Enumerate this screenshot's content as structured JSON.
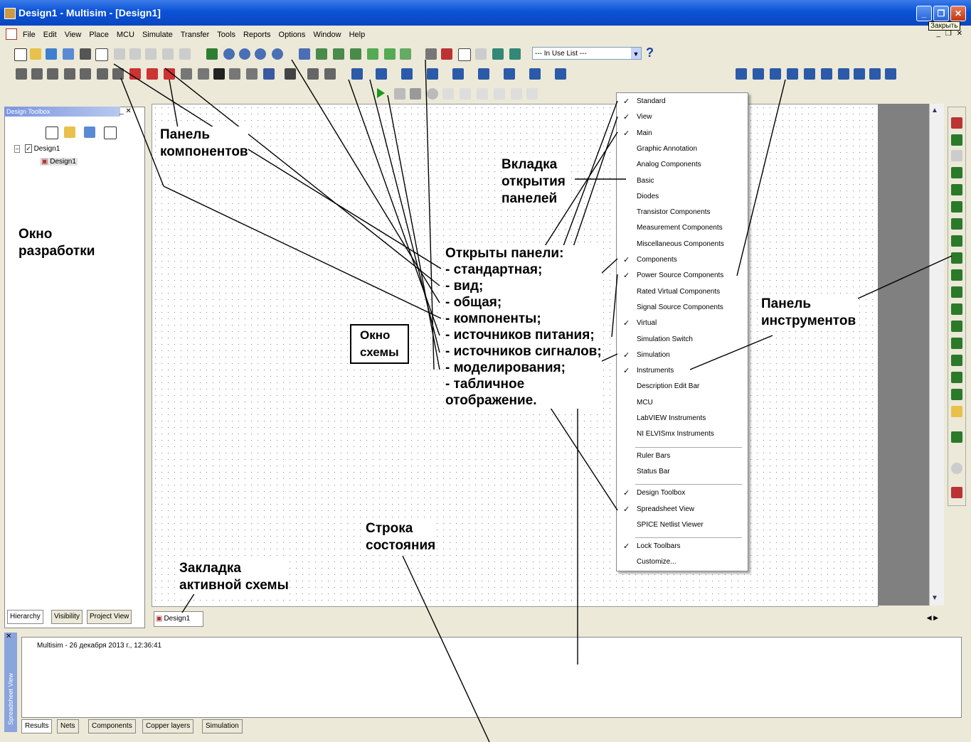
{
  "window": {
    "title": "Design1 - Multisim - [Design1]",
    "tooltip": "Закрыть"
  },
  "menubar": [
    "File",
    "Edit",
    "View",
    "Place",
    "MCU",
    "Simulate",
    "Transfer",
    "Tools",
    "Reports",
    "Options",
    "Window",
    "Help"
  ],
  "toolbar": {
    "inuse_list": "--- In Use List ---",
    "help": "?"
  },
  "design_toolbox": {
    "title": "Design Toolbox",
    "root": "Design1",
    "child": "Design1",
    "tabs": [
      "Hierarchy",
      "Visibility",
      "Project View"
    ]
  },
  "sheet_tab": "Design1",
  "view_menu": {
    "items": [
      {
        "label": "Standard",
        "checked": true
      },
      {
        "label": "View",
        "checked": true
      },
      {
        "label": "Main",
        "checked": true
      },
      {
        "label": "Graphic Annotation",
        "checked": false
      },
      {
        "label": "Analog Components",
        "checked": false
      },
      {
        "label": "Basic",
        "checked": false
      },
      {
        "label": "Diodes",
        "checked": false
      },
      {
        "label": "Transistor Components",
        "checked": false
      },
      {
        "label": "Measurement Components",
        "checked": false
      },
      {
        "label": "Miscellaneous Components",
        "checked": false
      },
      {
        "label": "Components",
        "checked": true
      },
      {
        "label": "Power Source Components",
        "checked": true
      },
      {
        "label": "Rated Virtual Components",
        "checked": false
      },
      {
        "label": "Signal Source Components",
        "checked": false
      },
      {
        "label": "Virtual",
        "checked": true
      },
      {
        "label": "Simulation Switch",
        "checked": false
      },
      {
        "label": "Simulation",
        "checked": true
      },
      {
        "label": "Instruments",
        "checked": true
      },
      {
        "label": "Description Edit Bar",
        "checked": false
      },
      {
        "label": "MCU",
        "checked": false
      },
      {
        "label": "LabVIEW Instruments",
        "checked": false
      },
      {
        "label": "NI ELVISmx Instruments",
        "checked": false
      },
      {
        "label": "Ruler Bars",
        "checked": false
      },
      {
        "label": "Status Bar",
        "checked": false
      },
      {
        "label": "Design Toolbox",
        "checked": true
      },
      {
        "label": "Spreadsheet View",
        "checked": true
      },
      {
        "label": "SPICE Netlist Viewer",
        "checked": false
      },
      {
        "label": "Lock Toolbars",
        "checked": true
      },
      {
        "label": "Customize...",
        "checked": false
      }
    ]
  },
  "status": {
    "text": "Multisim  -  26 декабря 2013 г., 12:36:41",
    "side_label": "Spreadsheet View",
    "tabs": [
      "Results",
      "Nets",
      "Components",
      "Copper layers",
      "Simulation"
    ]
  },
  "annotations": {
    "components_panel": [
      "Панель",
      "компонентов"
    ],
    "open_tab": [
      "Вкладка",
      "открытия",
      "панелей"
    ],
    "design_window": [
      "Окно",
      "разработки"
    ],
    "open_panels": [
      "Открыты панели:",
      "- стандартная;",
      "- вид;",
      "- общая;",
      "- компоненты;",
      "- источников питания;",
      "- источников сигналов;",
      "- моделирования;",
      "- табличное",
      "отображение."
    ],
    "schema_window": [
      "Окно",
      "схемы"
    ],
    "instruments_panel": [
      "Панель",
      "инструментов"
    ],
    "status_line": [
      "Строка",
      "состояния"
    ],
    "active_tab": [
      "Закладка",
      "активной схемы"
    ]
  }
}
